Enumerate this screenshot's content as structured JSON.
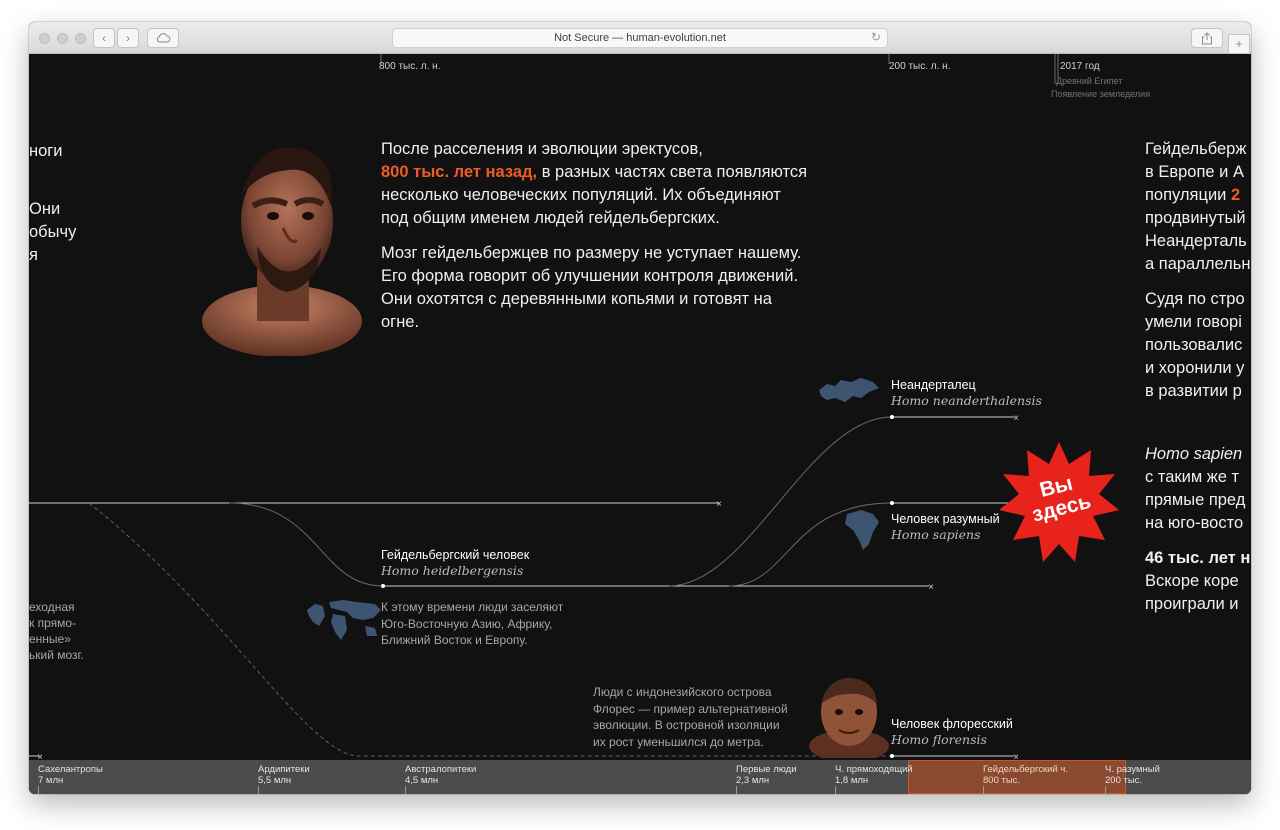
{
  "browser": {
    "address": "Not Secure — human-evolution.net"
  },
  "timeline_top": {
    "marks": [
      {
        "label": "800 тыс. л. н."
      },
      {
        "label": "200 тыс. л. н."
      },
      {
        "label": "2017 год"
      }
    ],
    "sub_labels": [
      "Древний Египет",
      "Появление земледелия"
    ]
  },
  "left_edge_text": {
    "lines": [
      "ноги",
      "",
      "Они",
      "обычу",
      "я"
    ],
    "note_lines": [
      "еходная",
      "к прямо-",
      "енные»",
      "ький мозг."
    ]
  },
  "main_text": {
    "p1_before": "После расселения и эволюции эректусов,",
    "p1_accent": "800 тыс. лет назад,",
    "p1_after": "в разных частях света появляются несколько человеческих популяций. Их объединяют под общим именем людей гейдельбергских.",
    "p2": "Мозг гейдельбержцев по размеру не уступает нашему. Его форма говорит об улучшении контроля движений. Они охотятся с деревянными копьями и готовят на огне."
  },
  "right_edge_text": {
    "lines": [
      "Гейдельберж",
      "в Европе и А",
      "популяции",
      "продвинутый",
      "Неандерталь",
      "а параллельн"
    ],
    "accent_fragment": "2",
    "lines2": [
      "Судя по стро",
      "умели говорі",
      "пользовалис",
      "и хоронили у",
      "в развитии р"
    ],
    "latin_fragment": "Homo sapien",
    "lines3": [
      "с таким же т",
      "прямые пред",
      "на юго-восто"
    ],
    "accent_line": "46 тыс. лет н",
    "lines4": [
      "Вскоре коре",
      "проиграли и"
    ]
  },
  "species": [
    {
      "name": "Неандерталец",
      "latin": "Homo neanderthalensis"
    },
    {
      "name": "Человек разумный",
      "latin": "Homo sapiens"
    },
    {
      "name": "Гейдельбергский человек",
      "latin": "Homo heidelbergensis"
    },
    {
      "name": "Человек флоресский",
      "latin": "Homo florensis"
    }
  ],
  "notes": {
    "heidelberg_map": [
      "К этому времени люди заселяют",
      "Юго-Восточную Азию, Африку,",
      "Ближний Восток и Европу."
    ],
    "flores": [
      "Люди с индонезийского острова",
      "Флорес — пример альтернативной",
      "эволюции. В островной изоляции",
      "их рост уменьшился до метра."
    ]
  },
  "badge": {
    "line1": "Вы",
    "line2": "здесь",
    "color": "#e8231c"
  },
  "eras": [
    {
      "name": "Сахелантропы",
      "age": "7 млн"
    },
    {
      "name": "Ардипитеки",
      "age": "5,5 млн"
    },
    {
      "name": "Австралопитеки",
      "age": "4,5 млн"
    },
    {
      "name": "Первые люди",
      "age": "2,3 млн"
    },
    {
      "name": "Ч. прямоходящий",
      "age": "1,8 млн"
    },
    {
      "name": "Гейдельбергский ч.",
      "age": "800 тыс."
    },
    {
      "name": "Ч. разумный",
      "age": "200 тыс."
    }
  ],
  "colors": {
    "accent": "#ee5c26",
    "background": "#111111",
    "era_active": "#8a4a30"
  }
}
